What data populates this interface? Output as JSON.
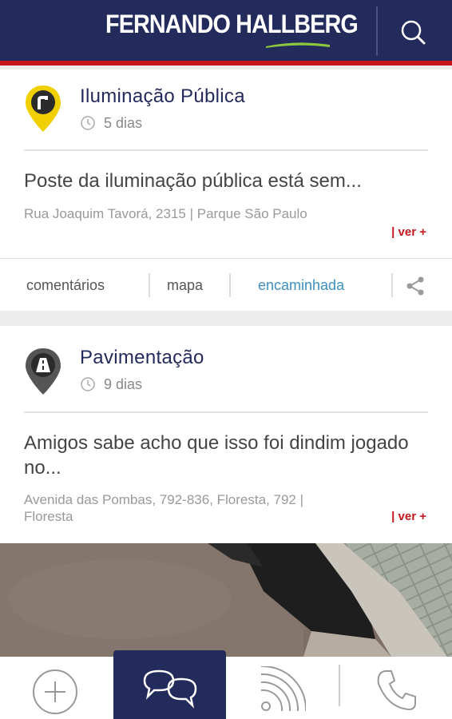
{
  "header": {
    "brand": "FERNANDO HALLBERG",
    "search_icon": "search-icon"
  },
  "cards": [
    {
      "category": "Iluminação Pública",
      "age": "5 dias",
      "title": "Poste da iluminação pública está sem...",
      "address": "Rua Joaquim Tavorá, 2315 | Parque São Paulo",
      "more": "| ver +",
      "pin_color": "#f0d000",
      "actions": {
        "comments": "comentários",
        "map": "mapa",
        "status": "encaminhada"
      }
    },
    {
      "category": "Pavimentação",
      "age": "9 dias",
      "title": "Amigos sabe acho que isso foi dindim jogado no...",
      "address": "Avenida das Pombas, 792-836, Floresta, 792 | Floresta",
      "more": "| ver +",
      "pin_color": "#555555"
    }
  ],
  "bottom_nav": {
    "items": [
      "add-icon",
      "chat-icon",
      "feed-icon",
      "phone-icon"
    ],
    "active": "chat-icon"
  },
  "colors": {
    "navy": "#232a5c",
    "red": "#c4161c",
    "link_blue": "#3d90c0",
    "brand_green": "#8dc63f"
  }
}
